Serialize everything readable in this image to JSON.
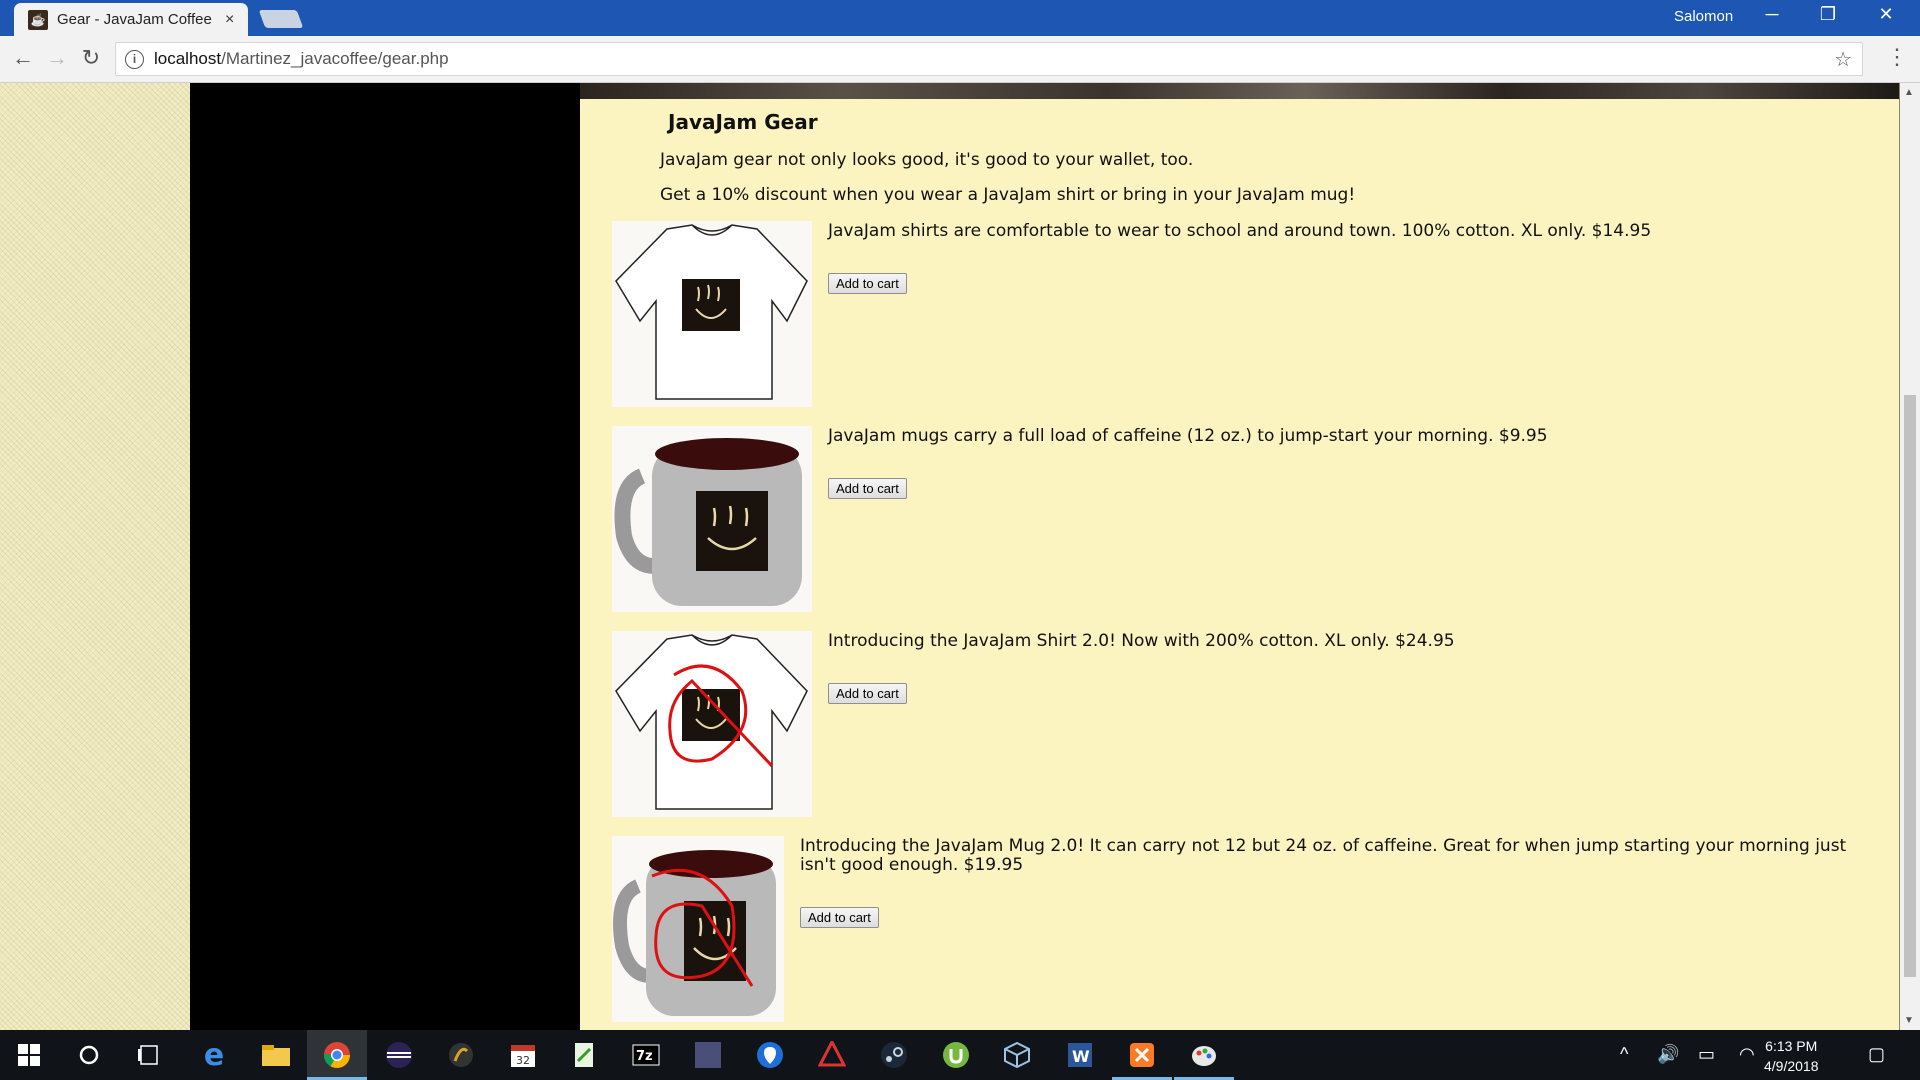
{
  "browser": {
    "tab_title": "Gear - JavaJam Coffee H",
    "tab_close": "×",
    "user": "Salomon",
    "minimize": "─",
    "restore": "❐",
    "close": "✕",
    "back": "←",
    "forward": "→",
    "reload": "↻",
    "url_host": "localhost",
    "url_path": "/Martinez_javacoffee/gear.php",
    "bookmark": "☆",
    "menu": "⋮"
  },
  "page": {
    "heading": "JavaJam Gear",
    "intro_1": "JavaJam gear not only looks good, it's good to your wallet, too.",
    "intro_2": "Get a 10% discount when you wear a JavaJam shirt or bring in your JavaJam mug!",
    "products": [
      {
        "desc": "JavaJam shirts are comfortable to wear to school and around town. 100% cotton. XL only. $14.95",
        "button": "Add to cart"
      },
      {
        "desc": "JavaJam mugs carry a full load of caffeine (12 oz.) to jump-start your morning. $9.95",
        "button": "Add to cart"
      },
      {
        "desc": "Introducing the JavaJam Shirt 2.0! Now with 200% cotton. XL only. $24.95",
        "button": "Add to cart"
      },
      {
        "desc": "Introducing the JavaJam Mug 2.0! It can carry not 12 but 24 oz. of caffeine. Great for when jump starting your morning just isn't good enough. $19.95",
        "button": "Add to cart"
      }
    ]
  },
  "taskbar": {
    "time": "6:13 PM",
    "date": "4/9/2018",
    "calendar_day": "32",
    "zip_label": "7z"
  },
  "colors": {
    "page_background": "#fcf4c0",
    "wrapper": "#000000",
    "titlebar": "#1d56b3"
  }
}
